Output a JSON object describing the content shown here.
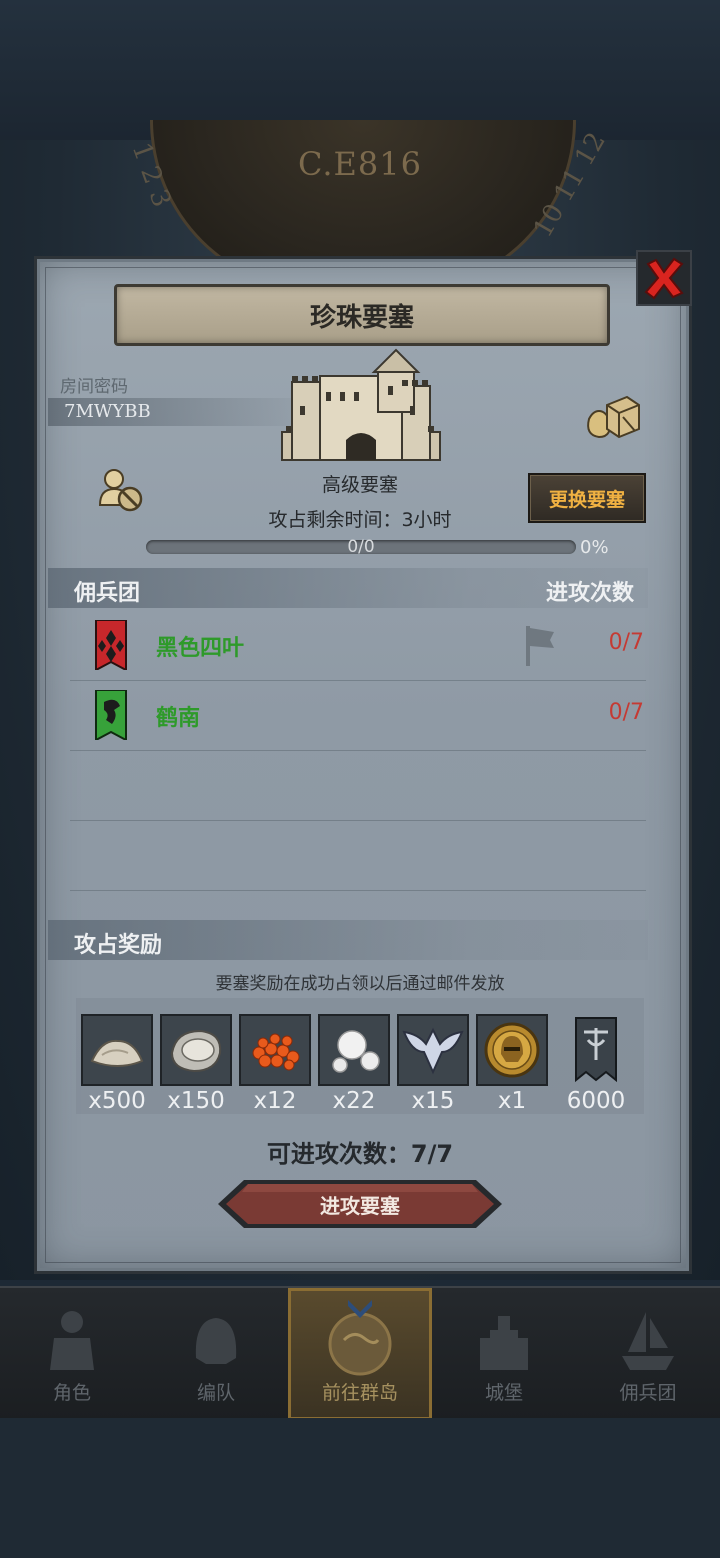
{
  "backdrop": {
    "year": "C.E816",
    "dial_left": "1 2 3",
    "dial_right": "10 11 12",
    "dial_gold": "11"
  },
  "panel": {
    "title": "珍珠要塞",
    "room_label": "房间密码",
    "room_code": "7MWYBB",
    "fortress_type": "高级要塞",
    "time_left": "攻占剩余时间：3小时",
    "change_button": "更换要塞",
    "progress_text": "0/0",
    "progress_percent": "0%",
    "progress_value": 0
  },
  "mercenary": {
    "section_title": "佣兵团",
    "attack_header": "进攻次数",
    "rows": [
      {
        "name": "黑色四叶",
        "count": "0/7",
        "banner_color": "#c7272b"
      },
      {
        "name": "鹤南",
        "count": "0/7",
        "banner_color": "#37a23a"
      }
    ]
  },
  "rewards": {
    "section_title": "攻占奖励",
    "note": "要塞奖励在成功占领以后通过邮件发放",
    "items": [
      {
        "icon": "sand-pile-icon",
        "qty": "x500"
      },
      {
        "icon": "oyster-icon",
        "qty": "x150"
      },
      {
        "icon": "fish-roe-icon",
        "qty": "x12"
      },
      {
        "icon": "pearls-icon",
        "qty": "x22"
      },
      {
        "icon": "bat-wing-emblem-icon",
        "qty": "x15"
      },
      {
        "icon": "gold-helmet-coin-icon",
        "qty": "x1"
      },
      {
        "icon": "war-banner-icon",
        "qty": "6000"
      }
    ]
  },
  "attack": {
    "attempts_left": "可进攻次数：7/7",
    "button_label": "进攻要塞"
  },
  "nav": {
    "items": [
      {
        "label": "角色",
        "icon": "knight-icon"
      },
      {
        "label": "编队",
        "icon": "helmet-icon"
      },
      {
        "label": "前往群岛",
        "icon": "globe-compass-icon"
      },
      {
        "label": "城堡",
        "icon": "castle-icon"
      },
      {
        "label": "佣兵团",
        "icon": "ship-icon"
      }
    ],
    "active_index": 2
  },
  "colors": {
    "accent_gold": "#f0b142",
    "guild_green": "#2e9a2a",
    "count_red": "#c53a33",
    "attack_button": "#7a3a34"
  }
}
